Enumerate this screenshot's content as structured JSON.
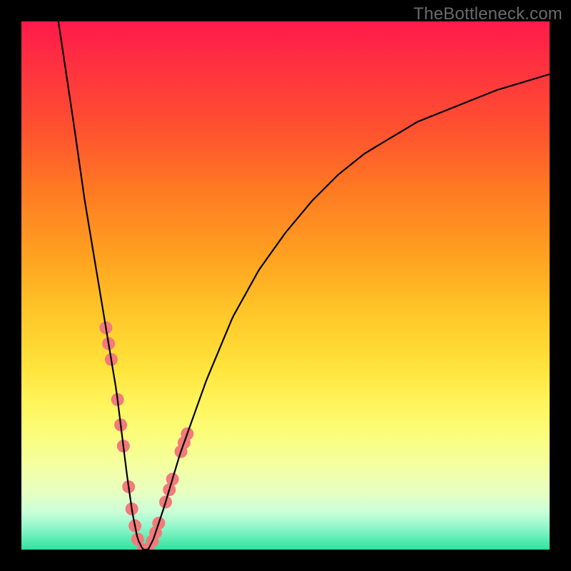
{
  "watermark": "TheBottleneck.com",
  "chart_data": {
    "type": "line",
    "title": "",
    "xlabel": "",
    "ylabel": "",
    "xlim": [
      0,
      100
    ],
    "ylim": [
      0,
      100
    ],
    "background_gradient": {
      "top": "#ff1a4b",
      "mid": "#ffe23a",
      "bottom": "#2de39e",
      "meaning": "red=high bottleneck, green=balanced"
    },
    "series": [
      {
        "name": "bottleneck-curve",
        "x": [
          7,
          10,
          12,
          14,
          16,
          18,
          19,
          20,
          21,
          22,
          23,
          24,
          25,
          27,
          30,
          35,
          40,
          45,
          50,
          55,
          60,
          65,
          70,
          75,
          80,
          85,
          90,
          95,
          100
        ],
        "values": [
          100,
          80,
          66,
          54,
          42,
          30,
          22,
          14,
          7,
          2,
          0,
          0,
          2,
          8,
          18,
          32,
          44,
          53,
          60,
          66,
          71,
          75,
          78,
          81,
          83,
          85,
          87,
          88.5,
          90
        ]
      }
    ],
    "marker_band": {
      "name": "highlighted-range-markers",
      "color": "#f27a7a",
      "points_on_curve_x": [
        16.0,
        16.5,
        17.0,
        18.2,
        18.8,
        19.3,
        20.3,
        20.9,
        21.5,
        22.0,
        23.0,
        24.0,
        24.8,
        25.4,
        26.0,
        27.3,
        28.0,
        28.6,
        30.2,
        30.8,
        31.4
      ]
    },
    "minimum_at_x": 23
  }
}
